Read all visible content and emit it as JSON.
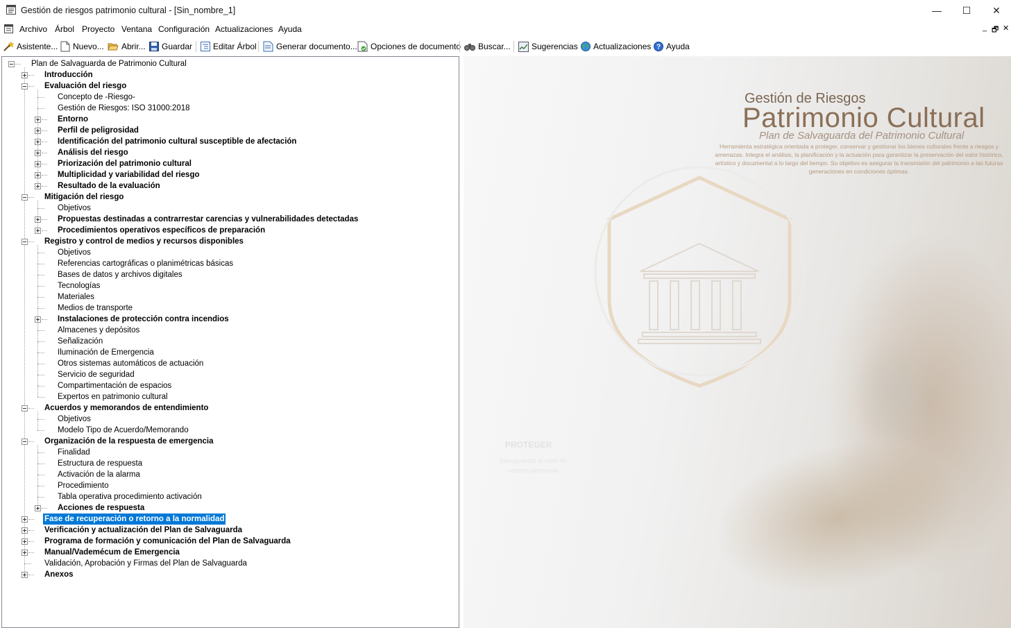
{
  "window": {
    "title": "Gestión de riesgos patrimonio cultural - [Sin_nombre_1]",
    "minimize": "—",
    "maximize": "☐",
    "close": "✕"
  },
  "menu": [
    "Archivo",
    "Árbol",
    "Proyecto",
    "Ventana",
    "Configuración",
    "Actualizaciones",
    "Ayuda"
  ],
  "mdi": {
    "minimize": "_",
    "restore": "🗗",
    "close": "✕"
  },
  "toolbar": [
    {
      "label": "Asistente...",
      "icon": "wand-icon"
    },
    {
      "label": "Nuevo...",
      "icon": "new-document-icon"
    },
    {
      "label": "Abrir...",
      "icon": "open-folder-icon"
    },
    {
      "label": "Guardar",
      "icon": "save-icon"
    },
    {
      "label": "Editar Árbol",
      "icon": "edit-tree-icon"
    },
    {
      "label": "Generar documento...",
      "icon": "generate-document-icon"
    },
    {
      "label": "Opciones de documento",
      "icon": "document-options-icon"
    },
    {
      "label": "Buscar...",
      "icon": "binoculars-icon"
    },
    {
      "label": "Sugerencias",
      "icon": "suggestions-icon"
    },
    {
      "label": "Actualizaciones",
      "icon": "updates-globe-icon"
    },
    {
      "label": "Ayuda",
      "icon": "help-icon"
    }
  ],
  "tree": [
    {
      "label": "Plan de Salvaguarda de Patrimonio Cultural",
      "level": 0,
      "bold": false,
      "expander": "minus"
    },
    {
      "label": "Introducción",
      "level": 1,
      "bold": true,
      "expander": "plus"
    },
    {
      "label": "Evaluación del riesgo",
      "level": 1,
      "bold": true,
      "expander": "minus"
    },
    {
      "label": "Concepto de -Riesgo-",
      "level": 2,
      "bold": false,
      "expander": "none"
    },
    {
      "label": "Gestión de Riesgos: ISO 31000:2018",
      "level": 2,
      "bold": false,
      "expander": "none"
    },
    {
      "label": "Entorno",
      "level": 2,
      "bold": true,
      "expander": "plus"
    },
    {
      "label": "Perfil de peligrosidad",
      "level": 2,
      "bold": true,
      "expander": "plus"
    },
    {
      "label": "Identificación del patrimonio cultural susceptible de afectación",
      "level": 2,
      "bold": true,
      "expander": "plus"
    },
    {
      "label": "Análisis del riesgo",
      "level": 2,
      "bold": true,
      "expander": "plus"
    },
    {
      "label": "Priorización del patrimonio cultural",
      "level": 2,
      "bold": true,
      "expander": "plus"
    },
    {
      "label": "Multiplicidad y variabilidad del riesgo",
      "level": 2,
      "bold": true,
      "expander": "plus"
    },
    {
      "label": "Resultado de la evaluación",
      "level": 2,
      "bold": true,
      "expander": "plus"
    },
    {
      "label": "Mitigación del riesgo",
      "level": 1,
      "bold": true,
      "expander": "minus"
    },
    {
      "label": "Objetivos",
      "level": 2,
      "bold": false,
      "expander": "none"
    },
    {
      "label": "Propuestas destinadas a contrarrestar carencias y vulnerabilidades detectadas",
      "level": 2,
      "bold": true,
      "expander": "plus"
    },
    {
      "label": "Procedimientos operativos específicos de preparación",
      "level": 2,
      "bold": true,
      "expander": "plus"
    },
    {
      "label": "Registro y control de medios y recursos disponibles",
      "level": 1,
      "bold": true,
      "expander": "minus"
    },
    {
      "label": "Objetivos",
      "level": 2,
      "bold": false,
      "expander": "none"
    },
    {
      "label": "Referencias cartográficas o planimétricas básicas",
      "level": 2,
      "bold": false,
      "expander": "none"
    },
    {
      "label": "Bases de datos y archivos digitales",
      "level": 2,
      "bold": false,
      "expander": "none"
    },
    {
      "label": "Tecnologías",
      "level": 2,
      "bold": false,
      "expander": "none"
    },
    {
      "label": "Materiales",
      "level": 2,
      "bold": false,
      "expander": "none"
    },
    {
      "label": "Medios de transporte",
      "level": 2,
      "bold": false,
      "expander": "none"
    },
    {
      "label": "Instalaciones de protección contra incendios",
      "level": 2,
      "bold": true,
      "expander": "plus"
    },
    {
      "label": "Almacenes y depósitos",
      "level": 2,
      "bold": false,
      "expander": "none"
    },
    {
      "label": "Señalización",
      "level": 2,
      "bold": false,
      "expander": "none"
    },
    {
      "label": "Iluminación de Emergencia",
      "level": 2,
      "bold": false,
      "expander": "none"
    },
    {
      "label": "Otros sistemas automáticos de actuación",
      "level": 2,
      "bold": false,
      "expander": "none"
    },
    {
      "label": "Servicio de seguridad",
      "level": 2,
      "bold": false,
      "expander": "none"
    },
    {
      "label": "Compartimentación de espacios",
      "level": 2,
      "bold": false,
      "expander": "none"
    },
    {
      "label": "Expertos en patrimonio cultural",
      "level": 2,
      "bold": false,
      "expander": "none"
    },
    {
      "label": "Acuerdos y memorandos de entendimiento",
      "level": 1,
      "bold": true,
      "expander": "minus"
    },
    {
      "label": "Objetivos",
      "level": 2,
      "bold": false,
      "expander": "none"
    },
    {
      "label": "Modelo Tipo de Acuerdo/Memorando",
      "level": 2,
      "bold": false,
      "expander": "none"
    },
    {
      "label": "Organización de la respuesta de emergencia",
      "level": 1,
      "bold": true,
      "expander": "minus"
    },
    {
      "label": "Finalidad",
      "level": 2,
      "bold": false,
      "expander": "none"
    },
    {
      "label": "Estructura de respuesta",
      "level": 2,
      "bold": false,
      "expander": "none"
    },
    {
      "label": "Activación de la alarma",
      "level": 2,
      "bold": false,
      "expander": "none"
    },
    {
      "label": "Procedimiento",
      "level": 2,
      "bold": false,
      "expander": "none"
    },
    {
      "label": "Tabla operativa procedimiento activación",
      "level": 2,
      "bold": false,
      "expander": "none"
    },
    {
      "label": "Acciones de respuesta",
      "level": 2,
      "bold": true,
      "expander": "plus"
    },
    {
      "label": "Fase de recuperación o retorno a la normalidad",
      "level": 1,
      "bold": true,
      "expander": "plus",
      "selected": true
    },
    {
      "label": "Verificación y actualización del Plan de Salvaguarda",
      "level": 1,
      "bold": true,
      "expander": "plus"
    },
    {
      "label": "Programa de formación y comunicación del Plan de Salvaguarda",
      "level": 1,
      "bold": true,
      "expander": "plus"
    },
    {
      "label": "Manual/Vademécum de Emergencia",
      "level": 1,
      "bold": true,
      "expander": "plus"
    },
    {
      "label": "Validación, Aprobación y Firmas del Plan de Salvaguarda",
      "level": 1,
      "bold": false,
      "expander": "none"
    },
    {
      "label": "Anexos",
      "level": 1,
      "bold": true,
      "expander": "plus"
    }
  ],
  "splash": {
    "subtitle_top": "Gestión de Riesgos",
    "title": "Patrimonio Cultural",
    "subtitle": "Plan de Salvaguarda del Patrimonio Cultural",
    "description": "Herramienta estratégica orientada a proteger, conservar y gestionar los bienes culturales frente a riesgos y amenazas. Integra el análisis, la planificación y la actuación para garantizar la preservación del valor histórico, artístico y documental a lo largo del tiempo. Su objetivo es asegurar la transmisión del patrimonio a las futuras generaciones en condiciones óptimas.",
    "proteger": "PROTEGER",
    "proteger_desc": "Salvaguardar el valor de nuestro patrimonio"
  },
  "colors": {
    "selection": "#0078d7",
    "splash_title": "#8a6f57",
    "splash_desc": "#b59a80"
  }
}
